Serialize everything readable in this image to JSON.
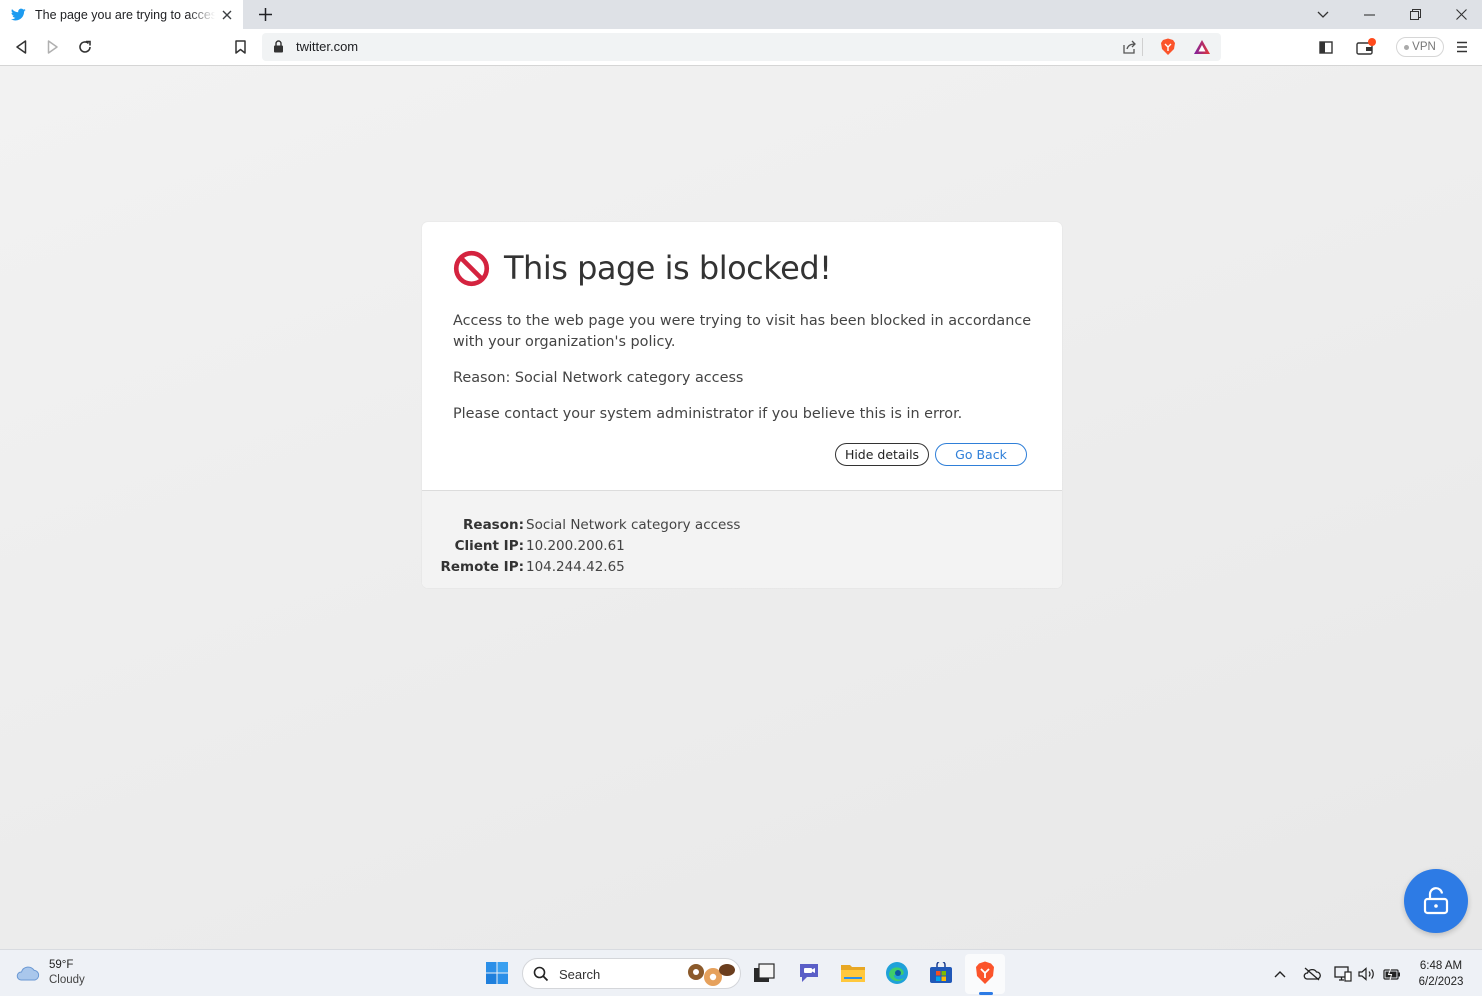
{
  "browser": {
    "tab": {
      "title": "The page you are trying to access is blocked",
      "favicon": "twitter-bird-icon"
    },
    "new_tab_symbol": "+",
    "url": "twitter.com",
    "vpn_label": "VPN",
    "accent_brave": "#fb542b"
  },
  "block_page": {
    "title": "This page is blocked!",
    "message": "Access to the web page you were trying to visit has been blocked in accordance with your organization's policy.",
    "reason_line": "Reason: Social Network category access",
    "contact_line": "Please contact your system administrator if you believe this is in error.",
    "hide_details_label": "Hide details",
    "go_back_label": "Go Back",
    "details": [
      {
        "label": "Reason:",
        "value": "Social Network category access"
      },
      {
        "label": "Client IP:",
        "value": "10.200.200.61"
      },
      {
        "label": "Remote IP:",
        "value": "104.244.42.65"
      }
    ],
    "block_color": "#d4233f",
    "link_color": "#2f7fd8"
  },
  "taskbar": {
    "weather": {
      "temp": "59°F",
      "condition": "Cloudy"
    },
    "search_label": "Search",
    "clock": {
      "time": "6:48 AM",
      "date": "6/2/2023"
    }
  }
}
